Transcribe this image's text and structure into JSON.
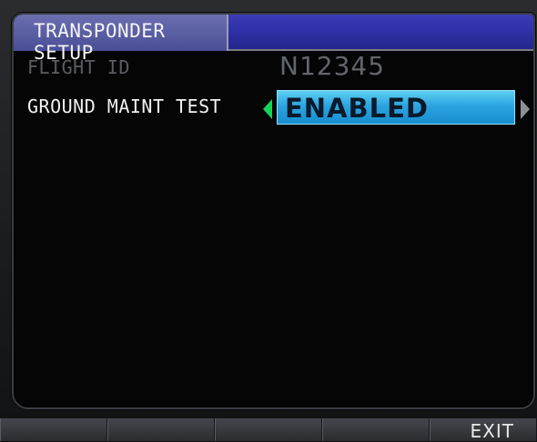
{
  "window": {
    "title": "TRANSPONDER SETUP"
  },
  "fields": {
    "flight_id": {
      "label": "FLIGHT ID",
      "value": "N12345"
    },
    "ground_maint_test": {
      "label": "GROUND MAINT TEST",
      "value": "ENABLED"
    }
  },
  "softkeys": {
    "labels": [
      "",
      "",
      "",
      "",
      "EXIT"
    ]
  },
  "colors": {
    "title_bar": "#2c2ea1",
    "selection": "#2ba4e0",
    "left_arrow": "#17d257",
    "disabled_text": "#5b5d62"
  }
}
